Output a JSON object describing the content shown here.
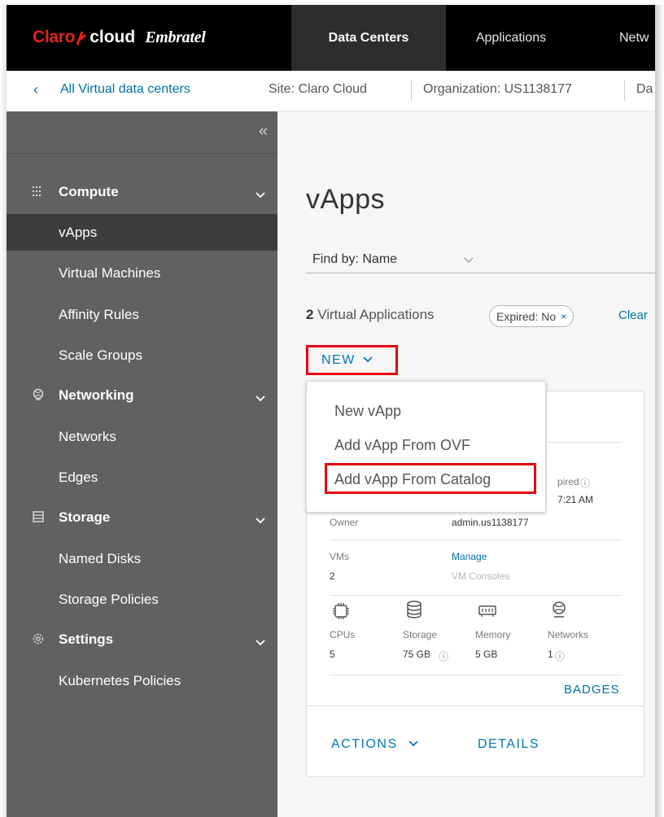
{
  "brand": {
    "part1": "Claro",
    "part2": "cloud",
    "part3": "Embratel"
  },
  "nav": {
    "data_centers": "Data Centers",
    "applications": "Applications",
    "networking_partial": "Netw"
  },
  "breadcrumb": {
    "back_label": "All Virtual data centers",
    "site": "Site: Claro Cloud",
    "organization": "Organization: US1138177",
    "datacenter_partial": "Da"
  },
  "sidebar": {
    "collapse_glyph": "«",
    "compute": {
      "label": "Compute",
      "icon": "compute-grid-icon"
    },
    "compute_items": [
      "vApps",
      "Virtual Machines",
      "Affinity Rules",
      "Scale Groups"
    ],
    "networking": {
      "label": "Networking",
      "icon": "networking-globe-icon"
    },
    "networking_items": [
      "Networks",
      "Edges"
    ],
    "storage": {
      "label": "Storage",
      "icon": "storage-disk-icon"
    },
    "storage_items": [
      "Named Disks",
      "Storage Policies"
    ],
    "settings": {
      "label": "Settings",
      "icon": "settings-gear-icon"
    },
    "settings_items": [
      "Kubernetes Policies"
    ]
  },
  "main": {
    "title": "vApps",
    "find_by": "Find by: Name",
    "count_number": "2",
    "count_label": " Virtual Applications",
    "filter_chip": "Expired: No",
    "filter_chip_close": "×",
    "clear_partial": "Clear",
    "new_label": "NEW"
  },
  "menu": {
    "items": [
      "New vApp",
      "Add vApp From OVF",
      "Add vApp From Catalog"
    ],
    "highlighted_index": 2
  },
  "card": {
    "expired_partial": "pired",
    "time_partial": "7:21 AM",
    "owner_key": "Owner",
    "owner_value": "admin.us1138177",
    "vms_key": "VMs",
    "vms_value": "2",
    "manage_link": "Manage",
    "consoles_link": "VM Consoles",
    "resources": [
      {
        "icon": "cpu-icon",
        "label": "CPUs",
        "value": "5"
      },
      {
        "icon": "storage-icon",
        "label": "Storage",
        "value": "75 GB"
      },
      {
        "icon": "memory-icon",
        "label": "Memory",
        "value": "5 GB"
      },
      {
        "icon": "network-icon",
        "label": "Networks",
        "value": "1"
      }
    ],
    "badges": "BADGES",
    "actions": "ACTIONS",
    "details": "DETAILS"
  },
  "colors": {
    "accent": "#0079b8",
    "highlight": "#e6000d",
    "sidebar": "#616161",
    "brand_red": "#e3241b"
  }
}
